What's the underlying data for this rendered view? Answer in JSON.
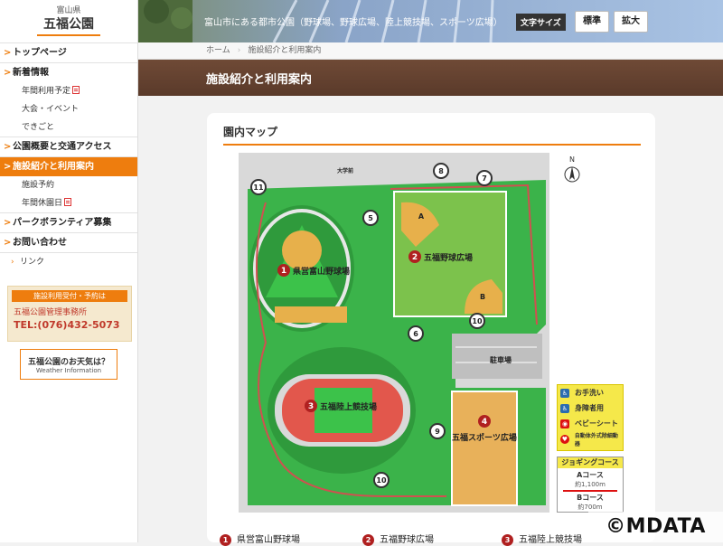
{
  "site": {
    "prefecture": "富山県",
    "name": "五福公園"
  },
  "nav": [
    {
      "label": "トップページ",
      "subs": []
    },
    {
      "label": "新着情報",
      "subs": [
        {
          "label": "年間利用予定",
          "pdf": true
        },
        {
          "label": "大会・イベント",
          "pdf": false
        },
        {
          "label": "できごと",
          "pdf": false
        }
      ]
    },
    {
      "label": "公園概要と交通アクセス",
      "subs": []
    },
    {
      "label": "施設紹介と利用案内",
      "active": true,
      "subs": [
        {
          "label": "施設予約",
          "pdf": false
        },
        {
          "label": "年間休園日",
          "pdf": true
        }
      ]
    },
    {
      "label": "パークボランティア募集",
      "subs": []
    },
    {
      "label": "お問い合わせ",
      "subs": []
    }
  ],
  "link_label": "リンク",
  "contact": {
    "header": "施設利用受付・予約は",
    "office": "五福公園管理事務所",
    "tel": "TEL:(076)432-5073"
  },
  "weather": {
    "title": "五福公園のお天気は？",
    "subtitle": "Weather Information"
  },
  "header": {
    "tagline": "富山市にある都市公園（野球場、野球広場、陸上競技場、スポーツ広場）",
    "fontsize_label": "文字サイズ",
    "standard": "標準",
    "large": "拡大"
  },
  "breadcrumb": {
    "home": "ホーム",
    "current": "施設紹介と利用案内"
  },
  "page_title": "施設紹介と利用案内",
  "section_title": "園内マップ",
  "map": {
    "facilities": [
      {
        "num": "1",
        "name": "県営富山野球場"
      },
      {
        "num": "2",
        "name": "五福野球広場"
      },
      {
        "num": "3",
        "name": "五福陸上競技場"
      },
      {
        "num": "4",
        "name": "五福スポーツ広場"
      }
    ],
    "markers": [
      "5",
      "6",
      "7",
      "8",
      "9",
      "10",
      "10",
      "11"
    ],
    "labels": {
      "parking": "駐車場",
      "north": "N",
      "univ": "大学前",
      "field_a": "A",
      "field_b": "B"
    }
  },
  "legend": {
    "items": [
      "お手洗い",
      "身障者用",
      "ベビーシート",
      "自動体外式除細動器"
    ]
  },
  "jogging": {
    "title": "ジョギングコース",
    "a_name": "Aコース",
    "a_len": "約1,100m",
    "b_name": "Bコース",
    "b_len": "約700m"
  },
  "bottom_list": [
    {
      "num": "1",
      "name": "県営富山野球場"
    },
    {
      "num": "2",
      "name": "五福野球広場"
    },
    {
      "num": "3",
      "name": "五福陸上競技場"
    }
  ],
  "copyright": "©MDATA",
  "colors": {
    "accent": "#ee7d0e",
    "facility_marker": "#b02020"
  }
}
